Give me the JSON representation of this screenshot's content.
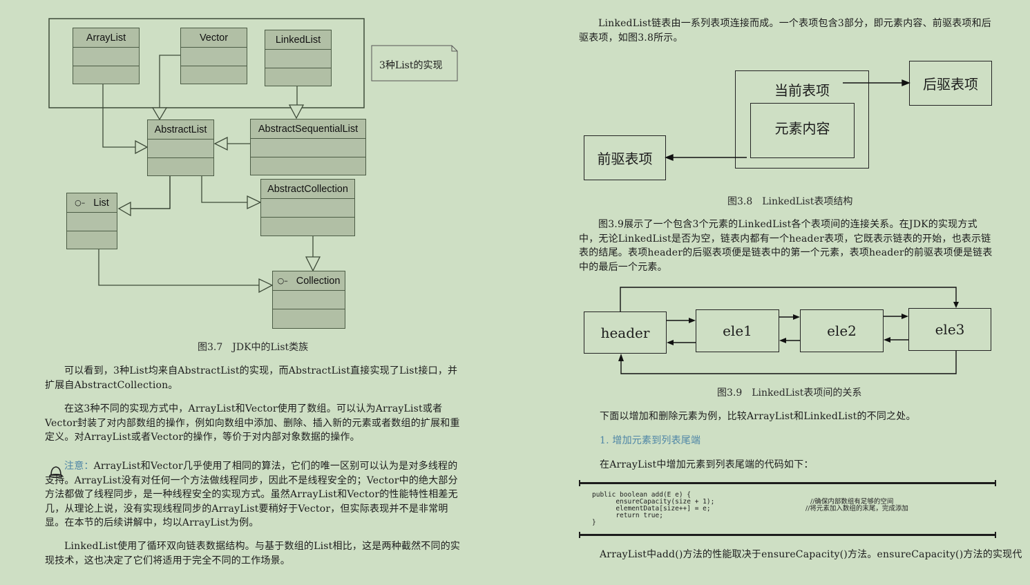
{
  "left_page": {
    "figure_3_7": {
      "classes": {
        "arraylist": "ArrayList",
        "vector": "Vector",
        "linkedlist": "LinkedList",
        "abstractlist": "AbstractList",
        "abstractsequentiallist": "AbstractSequentialList",
        "abstractcollection": "AbstractCollection",
        "list": "List",
        "collection": "Collection"
      },
      "interface_icon": "○–",
      "note": "3种List的实现",
      "caption": "图3.7　JDK中的List类族"
    },
    "paragraphs": [
      "可以看到，3种List均来自AbstractList的实现，而AbstractList直接实现了List接口，并扩展自AbstractCollection。",
      "在这3种不同的实现方式中，ArrayList和Vector使用了数组。可以认为ArrayList或者Vector封装了对内部数组的操作，例如向数组中添加、删除、插入新的元素或者数组的扩展和重定义。对ArrayList或者Vector的操作，等价于对内部对象数据的操作。"
    ],
    "note": {
      "icon": "bell-icon",
      "label": "注意：",
      "text": "ArrayList和Vector几乎使用了相同的算法，它们的唯一区别可以认为是对多线程的支持。ArrayList没有对任何一个方法做线程同步，因此不是线程安全的；Vector中的绝大部分方法都做了线程同步，是一种线程安全的实现方式。虽然ArrayList和Vector的性能特性相差无几，从理论上说，没有实现线程同步的ArrayList要稍好于Vector，但实际表现并不是非常明显。在本节的后续讲解中，均以ArrayList为例。"
    },
    "paragraph_last": "LinkedList使用了循环双向链表数据结构。与基于数组的List相比，这是两种截然不同的实现技术，这也决定了它们将适用于完全不同的工作场景。"
  },
  "right_page": {
    "intro": "LinkedList链表由一系列表项连接而成。一个表项包含3部分，即元素内容、前驱表项和后驱表项，如图3.8所示。",
    "figure_3_8": {
      "current": "当前表项",
      "content": "元素内容",
      "next": "后驱表项",
      "prev": "前驱表项",
      "caption": "图3.8　LinkedList表项结构"
    },
    "para_3_9": "图3.9展示了一个包含3个元素的LinkedList各个表项间的连接关系。在JDK的实现方式中，无论LinkedList是否为空，链表内都有一个header表项，它既表示链表的开始，也表示链表的结尾。表项header的后驱表项便是链表中的第一个元素，表项header的前驱表项便是链表中的最后一个元素。",
    "figure_3_9": {
      "nodes": [
        "header",
        "ele1",
        "ele2",
        "ele3"
      ],
      "caption": "图3.9　LinkedList表项间的关系"
    },
    "compare_text": "下面以增加和删除元素为例，比较ArrayList和LinkedList的不同之处。",
    "heading": "1. 增加元素到列表尾端",
    "code_intro": "在ArrayList中增加元素到列表尾端的代码如下：",
    "code": {
      "lines": [
        "public boolean add(E e) {",
        "      ensureCapacity(size + 1);",
        "      elementData[size++] = e;",
        "      return true;",
        "}"
      ],
      "comments": [
        "",
        " //确保内部数组有足够的空间",
        "//将元素加入数组的末尾，完成添加",
        "",
        ""
      ]
    },
    "last_line": "ArrayList中add()方法的性能取决于ensureCapacity()方法。ensureCapacity()方法的实现代"
  }
}
